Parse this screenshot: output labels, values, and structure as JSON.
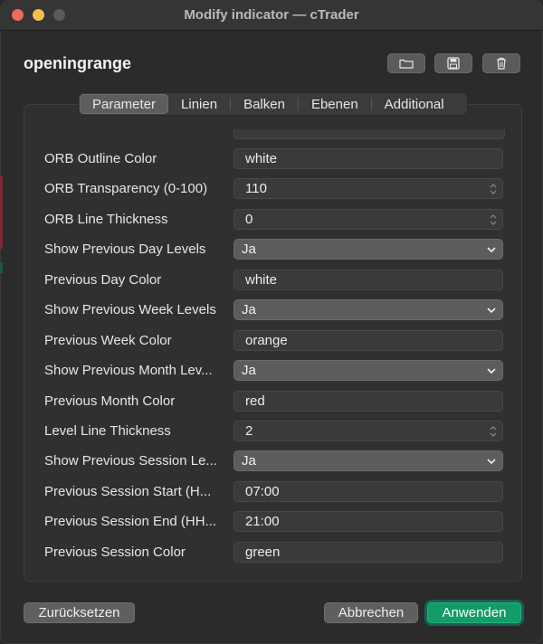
{
  "window": {
    "title": "Modify indicator — cTrader"
  },
  "indicator": {
    "name": "openingrange"
  },
  "toolbar": {
    "open_icon": "folder-icon",
    "save_icon": "floppy-disk-icon",
    "delete_icon": "trash-icon"
  },
  "tabs": [
    {
      "label": "Parameter",
      "active": true
    },
    {
      "label": "Linien"
    },
    {
      "label": "Balken"
    },
    {
      "label": "Ebenen"
    },
    {
      "label": "Additional"
    }
  ],
  "params": [
    {
      "label": "ORB Outline Color",
      "value": "white",
      "kind": "text"
    },
    {
      "label": "ORB Transparency (0-100)",
      "value": "110",
      "kind": "number"
    },
    {
      "label": "ORB Line Thickness",
      "value": "0",
      "kind": "number"
    },
    {
      "label": "Show Previous Day Levels",
      "value": "Ja",
      "kind": "select"
    },
    {
      "label": "Previous Day Color",
      "value": "white",
      "kind": "text"
    },
    {
      "label": "Show Previous Week Levels",
      "value": "Ja",
      "kind": "select"
    },
    {
      "label": "Previous Week Color",
      "value": "orange",
      "kind": "text"
    },
    {
      "label": "Show Previous Month Lev...",
      "value": "Ja",
      "kind": "select"
    },
    {
      "label": "Previous Month Color",
      "value": "red",
      "kind": "text"
    },
    {
      "label": "Level Line Thickness",
      "value": "2",
      "kind": "number"
    },
    {
      "label": "Show Previous Session Le...",
      "value": "Ja",
      "kind": "select"
    },
    {
      "label": "Previous Session Start (H...",
      "value": "07:00",
      "kind": "text"
    },
    {
      "label": "Previous Session End (HH...",
      "value": "21:00",
      "kind": "text"
    },
    {
      "label": "Previous Session Color",
      "value": "green",
      "kind": "text"
    }
  ],
  "footer": {
    "reset_label": "Zurücksetzen",
    "cancel_label": "Abbrechen",
    "apply_label": "Anwenden"
  },
  "colors": {
    "accent": "#149b67",
    "background": "#2b2b2b"
  }
}
